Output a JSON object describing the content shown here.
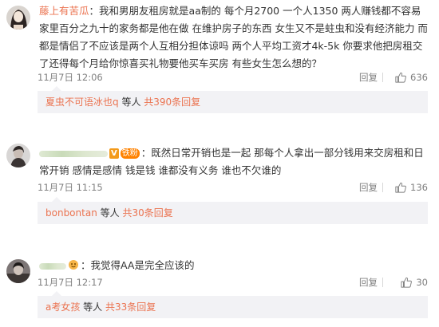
{
  "comments": [
    {
      "username": "藤上有苦瓜",
      "text": "我和男朋友租房就是aa制的 每个月2700 一个人1350 两人赚钱都不容易 家里百分之九十的家务都是他在做 在维护房子的东西 女生又不是蛀虫和没有经济能力 而都是情侣了不应该是两个人互相分担体谅吗 两个人平均工资才4k-5k 你要求他把房租交了还得每个月给你惊喜买礼物要他买车买房 有些女生怎么想的？",
      "time": "11月7日 12:06",
      "reply_label": "回复",
      "likes": "636",
      "sub_reply": {
        "user": "夏虫不可语冰也q",
        "middle": " 等人 ",
        "count_text": "共390条回复"
      }
    },
    {
      "username_blurred": true,
      "badge_v": "V",
      "badge_fan": "铁粉",
      "text": "既然日常开销也是一起  那每个人拿出一部分钱用来交房租和日常开销  感情是感情  钱是钱  谁都没有义务  谁也不欠谁的",
      "time": "11月7日 11:15",
      "reply_label": "回复",
      "likes": "136",
      "sub_reply": {
        "user": "bonbontan",
        "middle": " 等人 ",
        "count_text": "共30条回复"
      }
    },
    {
      "username_blurred": true,
      "text": "我觉得AA是完全应该的",
      "time": "11月7日 12:17",
      "reply_label": "回复",
      "likes": "30",
      "sub_reply": {
        "user": "a考女孩",
        "middle": " 等人 ",
        "count_text": "共33条回复"
      }
    }
  ],
  "colors": {
    "username": "#eb7350",
    "link_blue": "#507daf",
    "meta_gray": "#808080",
    "sub_bg": "#f2f2f5"
  }
}
